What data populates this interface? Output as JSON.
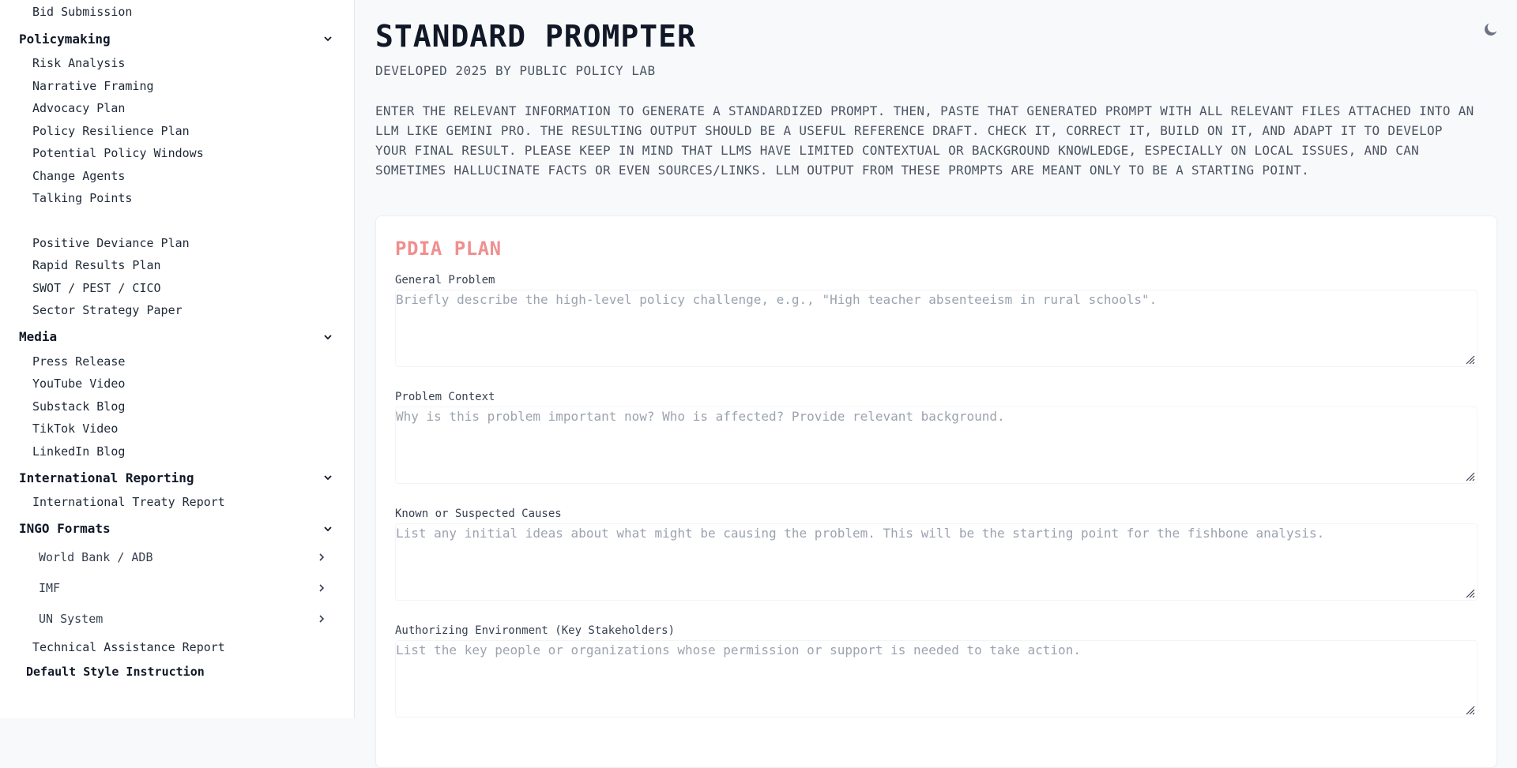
{
  "sidebar": {
    "top_item": "Bid Submission",
    "sections": [
      {
        "title": "Policymaking",
        "items": [
          "Risk Analysis",
          "Narrative Framing",
          "Advocacy Plan",
          "Policy Resilience Plan",
          "Potential Policy Windows",
          "Change Agents",
          "Talking Points"
        ],
        "items_after_gap": [
          "Positive Deviance Plan",
          "Rapid Results Plan",
          "SWOT / PEST / CICO",
          "Sector Strategy Paper"
        ]
      },
      {
        "title": "Media",
        "items": [
          "Press Release",
          "YouTube Video",
          "Substack Blog",
          "TikTok Video",
          "LinkedIn Blog"
        ]
      },
      {
        "title": "International Reporting",
        "items": [
          "International Treaty Report"
        ]
      },
      {
        "title": "INGO Formats",
        "subgroups": [
          "World Bank / ADB",
          "IMF",
          "UN System"
        ],
        "items": [
          "Technical Assistance Report"
        ]
      }
    ],
    "default_style": "Default Style Instruction"
  },
  "header": {
    "title": "STANDARD PROMPTER",
    "subtitle": "DEVELOPED 2025 BY PUBLIC POLICY LAB",
    "intro": "ENTER THE RELEVANT INFORMATION TO GENERATE A STANDARDIZED PROMPT. THEN, PASTE THAT GENERATED PROMPT WITH ALL RELEVANT FILES ATTACHED INTO AN LLM LIKE GEMINI PRO. THE RESULTING OUTPUT SHOULD BE A USEFUL REFERENCE DRAFT. CHECK IT, CORRECT IT, BUILD ON IT, AND ADAPT IT TO DEVELOP YOUR FINAL RESULT. PLEASE KEEP IN MIND THAT LLMS HAVE LIMITED CONTEXTUAL OR BACKGROUND KNOWLEDGE, ESPECIALLY ON LOCAL ISSUES, AND CAN SOMETIMES HALLUCINATE FACTS OR EVEN SOURCES/LINKS. LLM OUTPUT FROM THESE PROMPTS ARE MEANT ONLY TO BE A STARTING POINT."
  },
  "form": {
    "title": "PDIA PLAN",
    "fields": [
      {
        "label": "General Problem",
        "placeholder": "Briefly describe the high-level policy challenge, e.g., \"High teacher absenteeism in rural schools\"."
      },
      {
        "label": "Problem Context",
        "placeholder": "Why is this problem important now? Who is affected? Provide relevant background."
      },
      {
        "label": "Known or Suspected Causes",
        "placeholder": "List any initial ideas about what might be causing the problem. This will be the starting point for the fishbone analysis."
      },
      {
        "label": "Authorizing Environment (Key Stakeholders)",
        "placeholder": "List the key people or organizations whose permission or support is needed to take action."
      }
    ]
  },
  "colors": {
    "accent": "#f08f8f",
    "background": "#f8f9fb"
  },
  "icons": {
    "theme_toggle": "moon-icon",
    "section_toggle": "chevron-down-icon",
    "subgroup_toggle": "chevron-right-icon"
  }
}
